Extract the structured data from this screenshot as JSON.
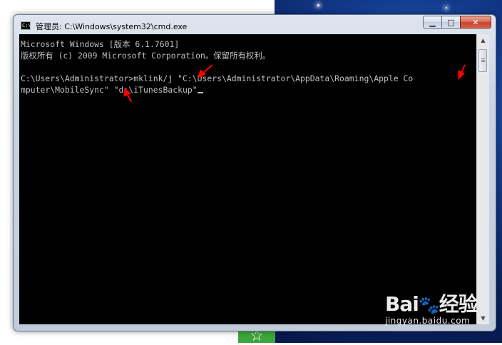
{
  "window": {
    "title": "管理员: C:\\Windows\\system32\\cmd.exe",
    "icon": "cmd-icon",
    "controls": {
      "minimize_label": "▁",
      "maximize_label": "□",
      "close_label": "✕"
    }
  },
  "console": {
    "lines": [
      "Microsoft Windows [版本 6.1.7601]",
      "版权所有 (c) 2009 Microsoft Corporation。保留所有权利。",
      "",
      "C:\\Users\\Administrator>mklink/j \"C:\\Users\\Administrator\\AppData\\Roaming\\Apple Co",
      "mputer\\MobileSync\" \"d:\\iTunesBackup\""
    ],
    "text_color": "#c0c0c0",
    "background": "#000000"
  },
  "scrollbar": {
    "up_icon": "▲",
    "down_icon": "▼"
  },
  "annotations": {
    "color": "#ff0000"
  },
  "watermark": {
    "logo_left": "Bai",
    "logo_right": "经验",
    "url": "jingyan.baidu.com"
  },
  "taskbar_tile": {
    "icon": "star-icon",
    "glyph": "☆"
  }
}
